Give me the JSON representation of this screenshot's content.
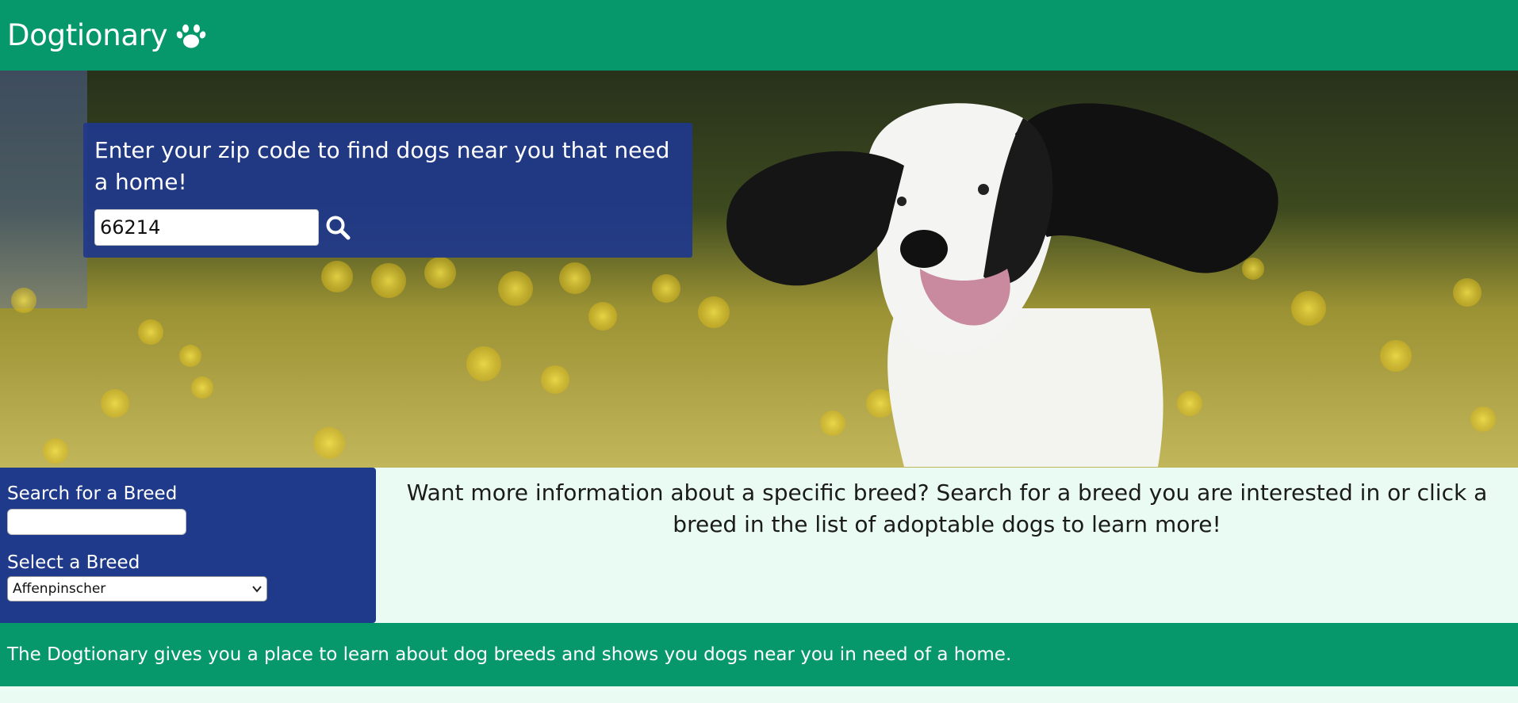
{
  "header": {
    "title": "Dogtionary",
    "icon": "paw-icon"
  },
  "hero": {
    "zip_prompt": "Enter your zip code to find dogs near you that need a home!",
    "zip_value": "66214",
    "search_icon": "search-icon"
  },
  "breed_panel": {
    "search_label": "Search for a Breed",
    "search_value": "",
    "select_label": "Select a Breed",
    "selected_breed": "Affenpinscher"
  },
  "info": {
    "text": "Want more information about a specific breed? Search for a breed you are interested in or click a breed in the list of adoptable dogs to learn more!"
  },
  "footer": {
    "text": "The Dogtionary gives you a place to learn about dog breeds and shows you dogs near you in need of a home."
  },
  "colors": {
    "header_green": "#06986a",
    "panel_blue": "#1f3a8a",
    "page_bg": "#e9fbf3"
  }
}
